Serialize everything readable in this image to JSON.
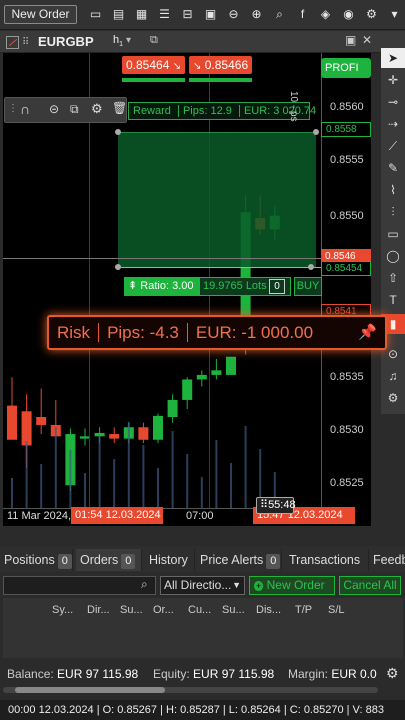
{
  "toolbar": {
    "new_order": "New Order",
    "icons": [
      "chart-type-icon",
      "layout-icon",
      "grid-icon",
      "list-icon",
      "template-icon",
      "image-icon",
      "zoom-out-icon",
      "zoom-in-icon",
      "search-icon",
      "facebook-icon",
      "layers-icon",
      "eye-icon",
      "settings-icon"
    ]
  },
  "tab": {
    "symbol": "EURGBP",
    "timeframe": "h",
    "timeframe_sub": "1"
  },
  "chart": {
    "price_labels": [
      "0.8560",
      "0.8555",
      "0.8550",
      "0.8545",
      "0.8535",
      "0.8530",
      "0.8525"
    ],
    "time_labels": [
      "11 Mar 2024,",
      "07:00"
    ],
    "crosshair_time": "01:54 12.03.2024",
    "crosshair_time_right": "15:47 12.03.2024",
    "countdown": "55:48",
    "bid": "0.85464",
    "ask": "0.85466",
    "tp_label": "Reward",
    "tp_pips": "Pips: 12.9",
    "tp_eur": "EUR: 3 020.74",
    "ratio": "Ratio: 3.00",
    "lots": "19.9765 Lots",
    "lots_step": "0",
    "buy": "BUY",
    "risk": "Risk",
    "risk_pips": "Pips: -4.3",
    "risk_eur": "EUR: -1 000.00",
    "tags": [
      "0.8558",
      "0.8546",
      "0.85454",
      "0.8541"
    ],
    "axis_sublabel": "10 - ps",
    "top_tag": "PROFI",
    "colors": {
      "up": "#1db33c",
      "down": "#e8482e",
      "zone": "#0b5c2a",
      "risk_border": "#e45a28"
    }
  },
  "candles": [
    {
      "o": 0.85295,
      "h": 0.8532,
      "l": 0.8527,
      "c": 0.85265
    },
    {
      "o": 0.8529,
      "h": 0.85305,
      "l": 0.8524,
      "c": 0.8526
    },
    {
      "o": 0.85285,
      "h": 0.8531,
      "l": 0.8527,
      "c": 0.85278
    },
    {
      "o": 0.85278,
      "h": 0.853,
      "l": 0.8527,
      "c": 0.85268
    },
    {
      "o": 0.85225,
      "h": 0.85275,
      "l": 0.8522,
      "c": 0.8527
    },
    {
      "o": 0.85266,
      "h": 0.85275,
      "l": 0.8526,
      "c": 0.85268
    },
    {
      "o": 0.85268,
      "h": 0.85276,
      "l": 0.85262,
      "c": 0.85271
    },
    {
      "o": 0.8527,
      "h": 0.85276,
      "l": 0.85262,
      "c": 0.85266
    },
    {
      "o": 0.85266,
      "h": 0.8528,
      "l": 0.85262,
      "c": 0.85276
    },
    {
      "o": 0.85276,
      "h": 0.8528,
      "l": 0.85262,
      "c": 0.85265
    },
    {
      "o": 0.85265,
      "h": 0.85288,
      "l": 0.85262,
      "c": 0.85286
    },
    {
      "o": 0.85285,
      "h": 0.85305,
      "l": 0.8528,
      "c": 0.853
    },
    {
      "o": 0.853,
      "h": 0.8532,
      "l": 0.85292,
      "c": 0.85318
    },
    {
      "o": 0.85318,
      "h": 0.85326,
      "l": 0.85312,
      "c": 0.85322
    },
    {
      "o": 0.85322,
      "h": 0.85336,
      "l": 0.85318,
      "c": 0.85326
    },
    {
      "o": 0.85322,
      "h": 0.85338,
      "l": 0.85322,
      "c": 0.85338
    },
    {
      "o": 0.85345,
      "h": 0.8548,
      "l": 0.8534,
      "c": 0.85465
    },
    {
      "o": 0.8546,
      "h": 0.8548,
      "l": 0.85445,
      "c": 0.8545
    },
    {
      "o": 0.8545,
      "h": 0.8547,
      "l": 0.8544,
      "c": 0.85462
    }
  ],
  "panel": {
    "tabs": [
      {
        "label": "Positions",
        "count": "0"
      },
      {
        "label": "Orders",
        "count": "0"
      },
      {
        "label": "History",
        "count": ""
      },
      {
        "label": "Price Alerts",
        "count": "0"
      },
      {
        "label": "Transactions",
        "count": ""
      },
      {
        "label": "Feedb",
        "count": ""
      }
    ],
    "direction_select": "All Directio...",
    "new_order": "New Order",
    "cancel_all": "Cancel All",
    "columns": [
      "Sy...",
      "Dir...",
      "Su...",
      "Or...",
      "Cu...",
      "Su...",
      "Dis...",
      "T/P",
      "S/L"
    ]
  },
  "status": {
    "balance_label": "Balance:",
    "balance": "EUR 97 115.98",
    "equity_label": "Equity:",
    "equity": "EUR 97 115.98",
    "margin_label": "Margin:",
    "margin": "EUR 0.0"
  },
  "bottom": "00:00 12.03.2024 | O: 0.85267 | H: 0.85287 | L: 0.85264 | C: 0.85270 | V: 883"
}
